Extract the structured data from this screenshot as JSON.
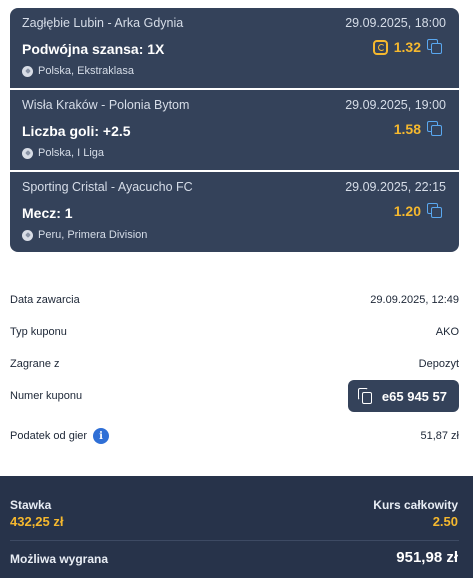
{
  "bets": [
    {
      "match": "Zagłębie Lubin - Arka Gdynia",
      "date": "29.09.2025, 18:00",
      "market": "Podwójna szansa: 1X",
      "odds": "1.32",
      "league": "Polska, Ekstraklasa",
      "boost_icon": "boost-icon"
    },
    {
      "match": "Wisła Kraków - Polonia Bytom",
      "date": "29.09.2025, 19:00",
      "market": "Liczba goli: +2.5",
      "odds": "1.58",
      "league": "Polska, I Liga"
    },
    {
      "match": "Sporting Cristal - Ayacucho FC",
      "date": "29.09.2025, 22:15",
      "market": "Mecz: 1",
      "odds": "1.20",
      "league": "Peru, Primera Division"
    }
  ],
  "details": {
    "date_label": "Data zawarcia",
    "date_value": "29.09.2025, 12:49",
    "type_label": "Typ kuponu",
    "type_value": "AKO",
    "played_label": "Zagrane z",
    "played_value": "Depozyt",
    "number_label": "Numer kuponu",
    "number_value": "e65 945 57",
    "tax_label": "Podatek od gier",
    "tax_value": "51,87 zł"
  },
  "summary": {
    "stake_label": "Stawka",
    "stake_value": "432,25 zł",
    "total_odds_label": "Kurs całkowity",
    "total_odds_value": "2.50",
    "win_label": "Możliwa wygrana",
    "win_value": "951,98 zł"
  },
  "colors": {
    "card_bg": "#34425a",
    "footer_bg": "#27334a",
    "odds": "#f5b82e",
    "share_icon": "#5aa8f0",
    "info_icon": "#2f6fd6"
  }
}
